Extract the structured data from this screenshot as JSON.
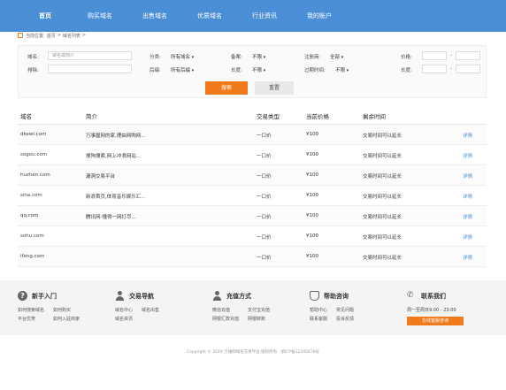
{
  "nav": {
    "items": [
      "首页",
      "购买域名",
      "出售域名",
      "优质域名",
      "行业资讯",
      "我的账户"
    ]
  },
  "breadcrumb": {
    "prefix": "当前位置:",
    "home": "首页",
    "sep": ">",
    "current": "域名列表",
    "arrow": ">"
  },
  "filters": {
    "row1": {
      "keyword_label": "域名:",
      "keyword_placeholder": "域名或简介",
      "category_label": "分类:",
      "category_value": "所有域名",
      "registered_label": "备案:",
      "registered_value": "不限",
      "registrar_label": "注册商:",
      "registrar_value": "全部",
      "price_label": "价格:",
      "price_dash": "-"
    },
    "row2": {
      "exclude_label": "排除:",
      "suffix_label": "后缀:",
      "suffix_value": "所有后缀",
      "length_label": "长度:",
      "length_value": "不限",
      "expire_label": "过期时间:",
      "expire_value": "不限",
      "len2_label": "长度:",
      "len2_dash": "-"
    }
  },
  "buttons": {
    "search": "搜索",
    "reset": "重置"
  },
  "table": {
    "headers": [
      "域名",
      "简介",
      "交易类型",
      "当前价格",
      "剩余时间"
    ],
    "rows": [
      {
        "domain": "dkewl.com",
        "desc": "万事屋网的家,理由网购网...",
        "type": "一口价",
        "price": "¥100",
        "time": "交易时间可以延长",
        "action": "详情"
      },
      {
        "domain": "sogou.com",
        "desc": "搜狗搜索,网上冲浪网站...",
        "type": "一口价",
        "price": "¥100",
        "time": "交易时间可以延长",
        "action": "详情"
      },
      {
        "domain": "huzhen.com",
        "desc": "漏洞交易平台",
        "type": "一口价",
        "price": "¥100",
        "time": "交易时间可以延长",
        "action": "详情"
      },
      {
        "domain": "sina.com",
        "desc": "新浪首页,体育音乐娱乐汇...",
        "type": "一口价",
        "price": "¥100",
        "time": "交易时间可以延长",
        "action": "详情"
      },
      {
        "domain": "qq.com",
        "desc": "腾讯网-懂得一网打尽...",
        "type": "一口价",
        "price": "¥100",
        "time": "交易时间可以延长",
        "action": "详情"
      },
      {
        "domain": "sohu.com",
        "desc": "",
        "type": "一口价",
        "price": "¥100",
        "time": "交易时间可以延长",
        "action": "详情"
      },
      {
        "domain": "ifeng.com",
        "desc": "",
        "type": "一口价",
        "price": "¥100",
        "time": "交易时间可以延长",
        "action": "详情"
      }
    ]
  },
  "footer": {
    "cols": [
      {
        "title": "新手入门",
        "links": [
          "如何搜索域名",
          "如何购买",
          "平台优势",
          "如何入驻商家"
        ]
      },
      {
        "title": "交易导航",
        "links": [
          "域名中心",
          "域名出售",
          "域名资讯"
        ]
      },
      {
        "title": "充值方式",
        "links": [
          "微信充值",
          "支付宝充值",
          "网银汇款充值",
          "网银转账"
        ]
      },
      {
        "title": "帮助咨询",
        "links": [
          "帮助中心",
          "常见问题",
          "联系客服",
          "投诉反馈"
        ]
      },
      {
        "title": "联系我们",
        "hotline": "周一至周日9:00 - 23:00",
        "button": "在线客服咨询"
      }
    ],
    "copyright": "Copyright © 2019 万维网域名交易平台 版权所有 · 浙ICP备12345678号"
  },
  "colors": {
    "nav_bg": "#4a8fd6",
    "accent": "#f07a1a",
    "link": "#4a8fd6"
  }
}
